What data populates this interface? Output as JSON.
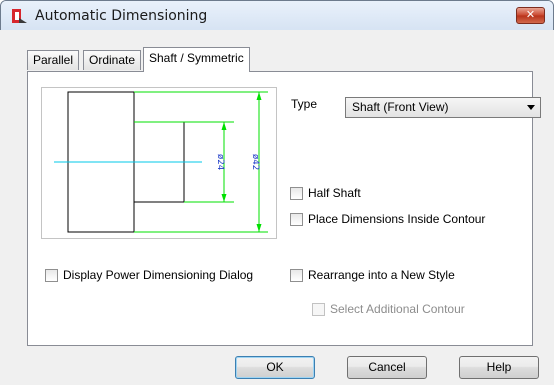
{
  "window": {
    "title": "Automatic Dimensioning",
    "close_glyph": "✕"
  },
  "tabs": [
    {
      "label": "Parallel",
      "active": false
    },
    {
      "label": "Ordinate",
      "active": false
    },
    {
      "label": "Shaft / Symmetric",
      "active": true
    }
  ],
  "preview": {
    "dim_inner": "ø24",
    "dim_outer": "ø42"
  },
  "type": {
    "label": "Type",
    "selected": "Shaft (Front View)"
  },
  "options": {
    "half_shaft": "Half Shaft",
    "place_inside": "Place Dimensions Inside Contour",
    "display_power": "Display Power Dimensioning Dialog",
    "rearrange": "Rearrange into a New Style",
    "select_additional": "Select Additional Contour"
  },
  "buttons": {
    "ok": "OK",
    "cancel": "Cancel",
    "help": "Help"
  },
  "colors": {
    "dimension_green": "#00e000",
    "centerline_cyan": "#00c8e8",
    "dim_text_blue": "#1e3cc8"
  }
}
